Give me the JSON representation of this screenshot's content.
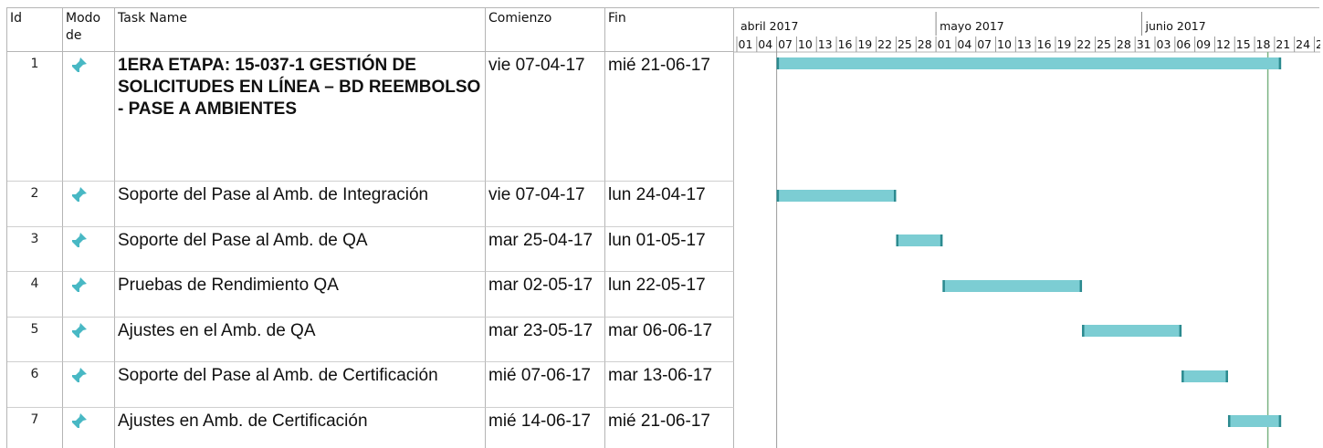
{
  "headers": {
    "id": "Id",
    "mode": "Modo de",
    "name": "Task Name",
    "start": "Comienzo",
    "end": "Fin"
  },
  "timeline": {
    "months": [
      {
        "label": "abril 2017",
        "date": "2017-04-01"
      },
      {
        "label": "mayo 2017",
        "date": "2017-05-01"
      },
      {
        "label": "junio 2017",
        "date": "2017-06-01"
      }
    ],
    "start_date": "2017-04-01",
    "ticks": [
      "01",
      "04",
      "07",
      "10",
      "13",
      "16",
      "19",
      "22",
      "25",
      "28",
      "01",
      "04",
      "07",
      "10",
      "13",
      "16",
      "19",
      "22",
      "25",
      "28",
      "31",
      "03",
      "06",
      "09",
      "12",
      "15",
      "18",
      "21",
      "24",
      "2"
    ],
    "marker_date": "2017-06-20"
  },
  "colors": {
    "bar": "#7ccdd3",
    "bar_end": "#2c8a8f",
    "pin": "#48b8c4",
    "marker": "#7bb383"
  },
  "tasks": [
    {
      "id": "1",
      "name": "1ERA ETAPA: 15-037-1 GESTIÓN DE SOLICITUDES EN LÍNEA – BD REEMBOLSO - PASE A AMBIENTES",
      "start": "vie 07-04-17",
      "end": "mié 21-06-17",
      "bold": true,
      "start_date": "2017-04-07",
      "end_date": "2017-06-21",
      "icon": "pin-icon"
    },
    {
      "id": "2",
      "name": "Soporte del Pase al Amb. de Integración",
      "start": "vie 07-04-17",
      "end": "lun 24-04-17",
      "bold": false,
      "start_date": "2017-04-07",
      "end_date": "2017-04-24",
      "icon": "pin-icon"
    },
    {
      "id": "3",
      "name": "Soporte del Pase al Amb. de QA",
      "start": "mar 25-04-17",
      "end": "lun 01-05-17",
      "bold": false,
      "start_date": "2017-04-25",
      "end_date": "2017-05-01",
      "icon": "pin-icon"
    },
    {
      "id": "4",
      "name": "Pruebas de Rendimiento QA",
      "start": "mar 02-05-17",
      "end": "lun 22-05-17",
      "bold": false,
      "start_date": "2017-05-02",
      "end_date": "2017-05-22",
      "icon": "pin-icon"
    },
    {
      "id": "5",
      "name": "Ajustes en el Amb. de QA",
      "start": "mar 23-05-17",
      "end": "mar 06-06-17",
      "bold": false,
      "start_date": "2017-05-23",
      "end_date": "2017-06-06",
      "icon": "pin-icon"
    },
    {
      "id": "6",
      "name": "Soporte del Pase al Amb. de Certificación",
      "start": "mié 07-06-17",
      "end": "mar 13-06-17",
      "bold": false,
      "start_date": "2017-06-07",
      "end_date": "2017-06-13",
      "icon": "pin-icon"
    },
    {
      "id": "7",
      "name": "Ajustes en Amb. de Certificación",
      "start": "mié 14-06-17",
      "end": "mié 21-06-17",
      "bold": false,
      "start_date": "2017-06-14",
      "end_date": "2017-06-21",
      "icon": "pin-icon"
    }
  ]
}
